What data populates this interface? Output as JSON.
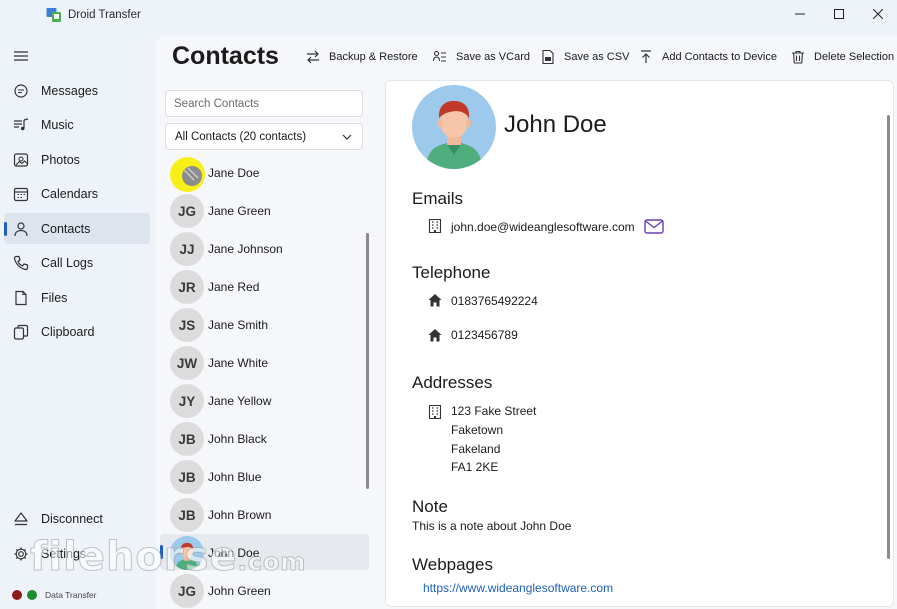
{
  "app": {
    "title": "Droid Transfer"
  },
  "nav": {
    "items": [
      {
        "label": "Messages",
        "icon": "messages-icon"
      },
      {
        "label": "Music",
        "icon": "music-icon"
      },
      {
        "label": "Photos",
        "icon": "photos-icon"
      },
      {
        "label": "Calendars",
        "icon": "calendar-icon"
      },
      {
        "label": "Contacts",
        "icon": "contacts-icon",
        "active": true
      },
      {
        "label": "Call Logs",
        "icon": "phone-icon"
      },
      {
        "label": "Files",
        "icon": "file-icon"
      },
      {
        "label": "Clipboard",
        "icon": "clipboard-icon"
      }
    ],
    "bottom": [
      {
        "label": "Disconnect",
        "icon": "eject-icon"
      },
      {
        "label": "Settings",
        "icon": "gear-icon"
      }
    ],
    "status": {
      "label": "Data Transfer",
      "colors": [
        "#8b1a1a",
        "#1f8a2e"
      ]
    }
  },
  "page": {
    "title": "Contacts"
  },
  "toolbar": {
    "backup_label": "Backup & Restore",
    "vcard_label": "Save as VCard",
    "csv_label": "Save as CSV",
    "add_label": "Add Contacts to Device",
    "delete_label": "Delete Selection"
  },
  "search": {
    "placeholder": "Search Contacts"
  },
  "filter": {
    "selected": "All Contacts (20 contacts)"
  },
  "contacts": [
    {
      "initials": "",
      "name": "Jane Doe",
      "photo": true
    },
    {
      "initials": "JG",
      "name": "Jane Green"
    },
    {
      "initials": "JJ",
      "name": "Jane Johnson"
    },
    {
      "initials": "JR",
      "name": "Jane Red"
    },
    {
      "initials": "JS",
      "name": "Jane Smith"
    },
    {
      "initials": "JW",
      "name": "Jane White"
    },
    {
      "initials": "JY",
      "name": "Jane Yellow"
    },
    {
      "initials": "JB",
      "name": "John Black"
    },
    {
      "initials": "JB",
      "name": "John Blue"
    },
    {
      "initials": "JB",
      "name": "John Brown"
    },
    {
      "initials": "",
      "name": "John Doe",
      "photo": true,
      "selected": true
    },
    {
      "initials": "JG",
      "name": "John Green"
    }
  ],
  "detail": {
    "name": "John Doe",
    "emails_title": "Emails",
    "email": "john.doe@wideanglesoftware.com",
    "telephone_title": "Telephone",
    "phones": [
      "0183765492224",
      "0123456789"
    ],
    "addresses_title": "Addresses",
    "address_lines": [
      "123 Fake Street",
      "Faketown",
      "Fakeland",
      "FA1 2KE"
    ],
    "note_title": "Note",
    "note": "This is a note about John Doe",
    "webpages_title": "Webpages",
    "webpage": "https://www.wideanglesoftware.com"
  },
  "watermark": {
    "text": "filehorse",
    "suffix": ".com"
  },
  "colors": {
    "accent": "#1f5fbf",
    "email_action": "#6a3fb5"
  }
}
